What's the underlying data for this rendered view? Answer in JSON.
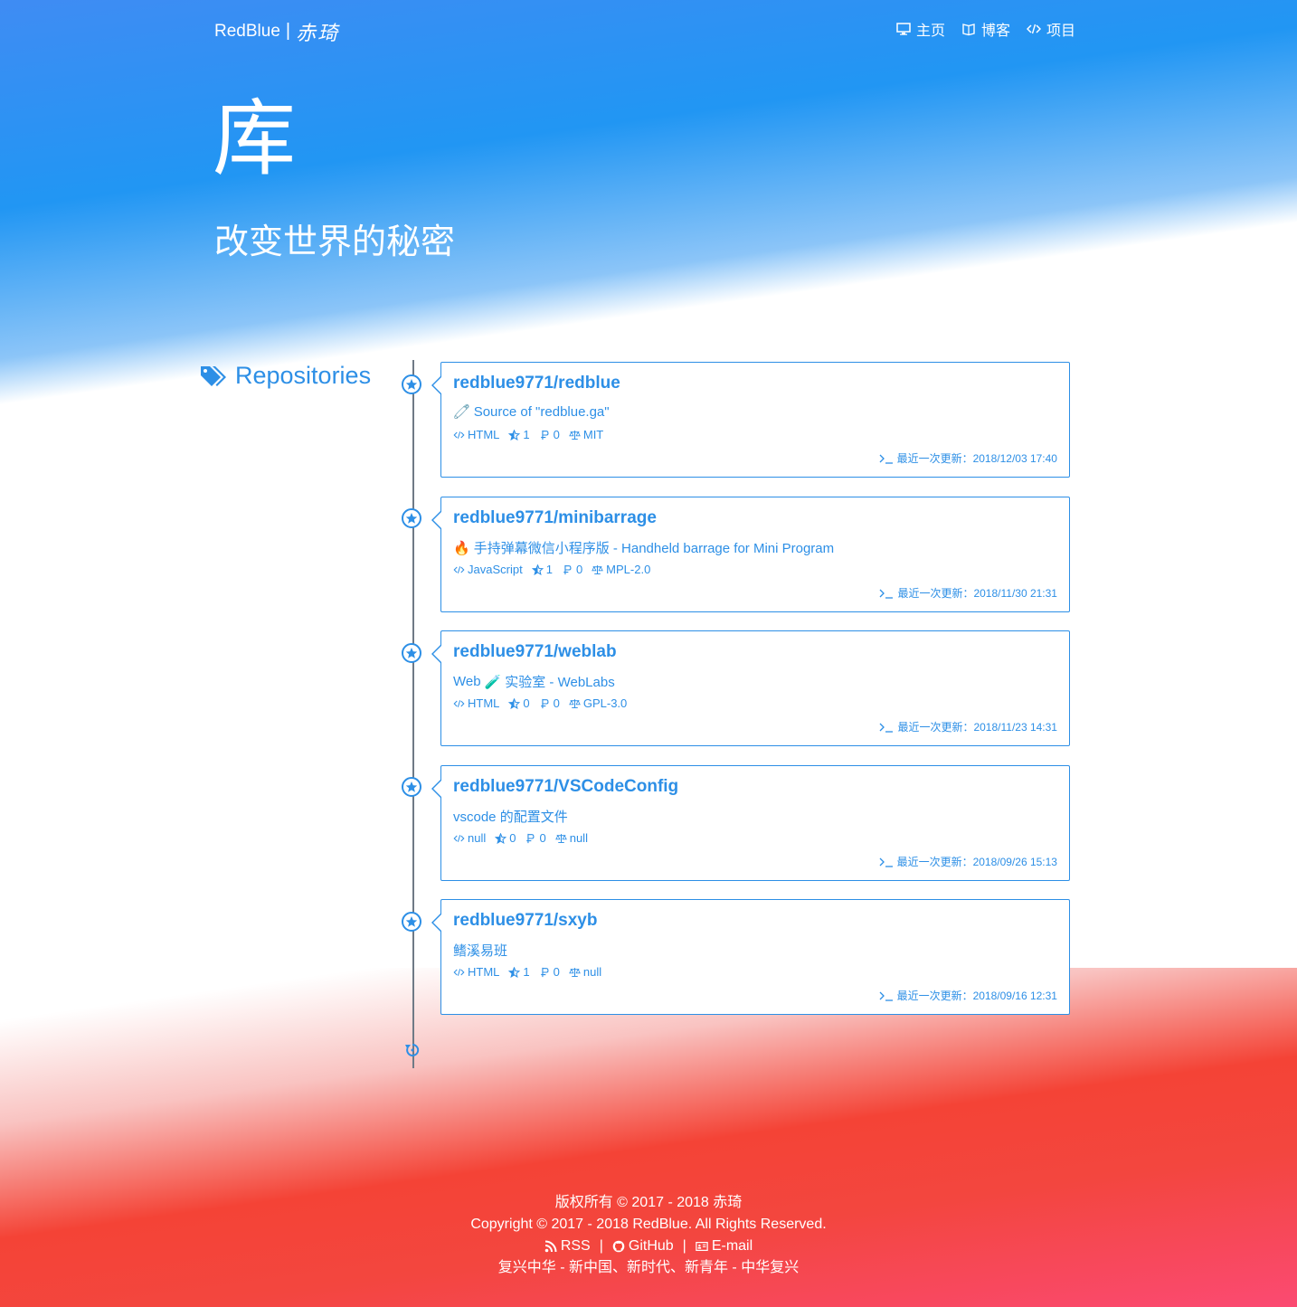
{
  "header": {
    "brand": "RedBlue",
    "brand_sep": "|",
    "brand_script": "赤琦",
    "nav": [
      {
        "label": "主页",
        "icon": "desktop-icon"
      },
      {
        "label": "博客",
        "icon": "book-icon"
      },
      {
        "label": "项目",
        "icon": "code-icon"
      }
    ]
  },
  "hero": {
    "title": "库",
    "subtitle": "改变世界的秘密"
  },
  "section": {
    "label": "Repositories",
    "icon": "tags-icon"
  },
  "repos": [
    {
      "name": "redblue9771/redblue",
      "emoji": "🧷",
      "description": "Source of \"redblue.ga\"",
      "language": "HTML",
      "stars": "1",
      "forks": "0",
      "license": "MIT",
      "updated": "最近一次更新：2018/12/03 17:40"
    },
    {
      "name": "redblue9771/minibarrage",
      "emoji": "🔥",
      "description": "手持弹幕微信小程序版 - Handheld barrage for Mini Program",
      "language": "JavaScript",
      "stars": "1",
      "forks": "0",
      "license": "MPL-2.0",
      "updated": "最近一次更新：2018/11/30 21:31"
    },
    {
      "name": "redblue9771/weblab",
      "desc_prefix": "Web",
      "emoji": "🧪",
      "description": "实验室 - WebLabs",
      "language": "HTML",
      "stars": "0",
      "forks": "0",
      "license": "GPL-3.0",
      "updated": "最近一次更新：2018/11/23 14:31"
    },
    {
      "name": "redblue9771/VSCodeConfig",
      "description": "vscode 的配置文件",
      "language": "null",
      "stars": "0",
      "forks": "0",
      "license": "null",
      "updated": "最近一次更新：2018/09/26 15:13"
    },
    {
      "name": "redblue9771/sxyb",
      "description": "鳍溪易班",
      "language": "HTML",
      "stars": "1",
      "forks": "0",
      "license": "null",
      "updated": "最近一次更新：2018/09/16 12:31"
    }
  ],
  "footer": {
    "line1": "版权所有 © 2017 - 2018 赤琦",
    "line2": "Copyright © 2017 - 2018 RedBlue. All Rights Reserved.",
    "links": [
      {
        "label": "RSS",
        "icon": "rss-icon"
      },
      {
        "label": "GitHub",
        "icon": "github-icon"
      },
      {
        "label": "E-mail",
        "icon": "id-card-icon"
      }
    ],
    "link_sep": "|",
    "line4": "复兴中华 - 新中国、新时代、新青年 - 中华复兴"
  },
  "colors": {
    "accent": "#2d8fe6",
    "hero_blue": "#2196f3",
    "footer_red": "#f44336"
  }
}
